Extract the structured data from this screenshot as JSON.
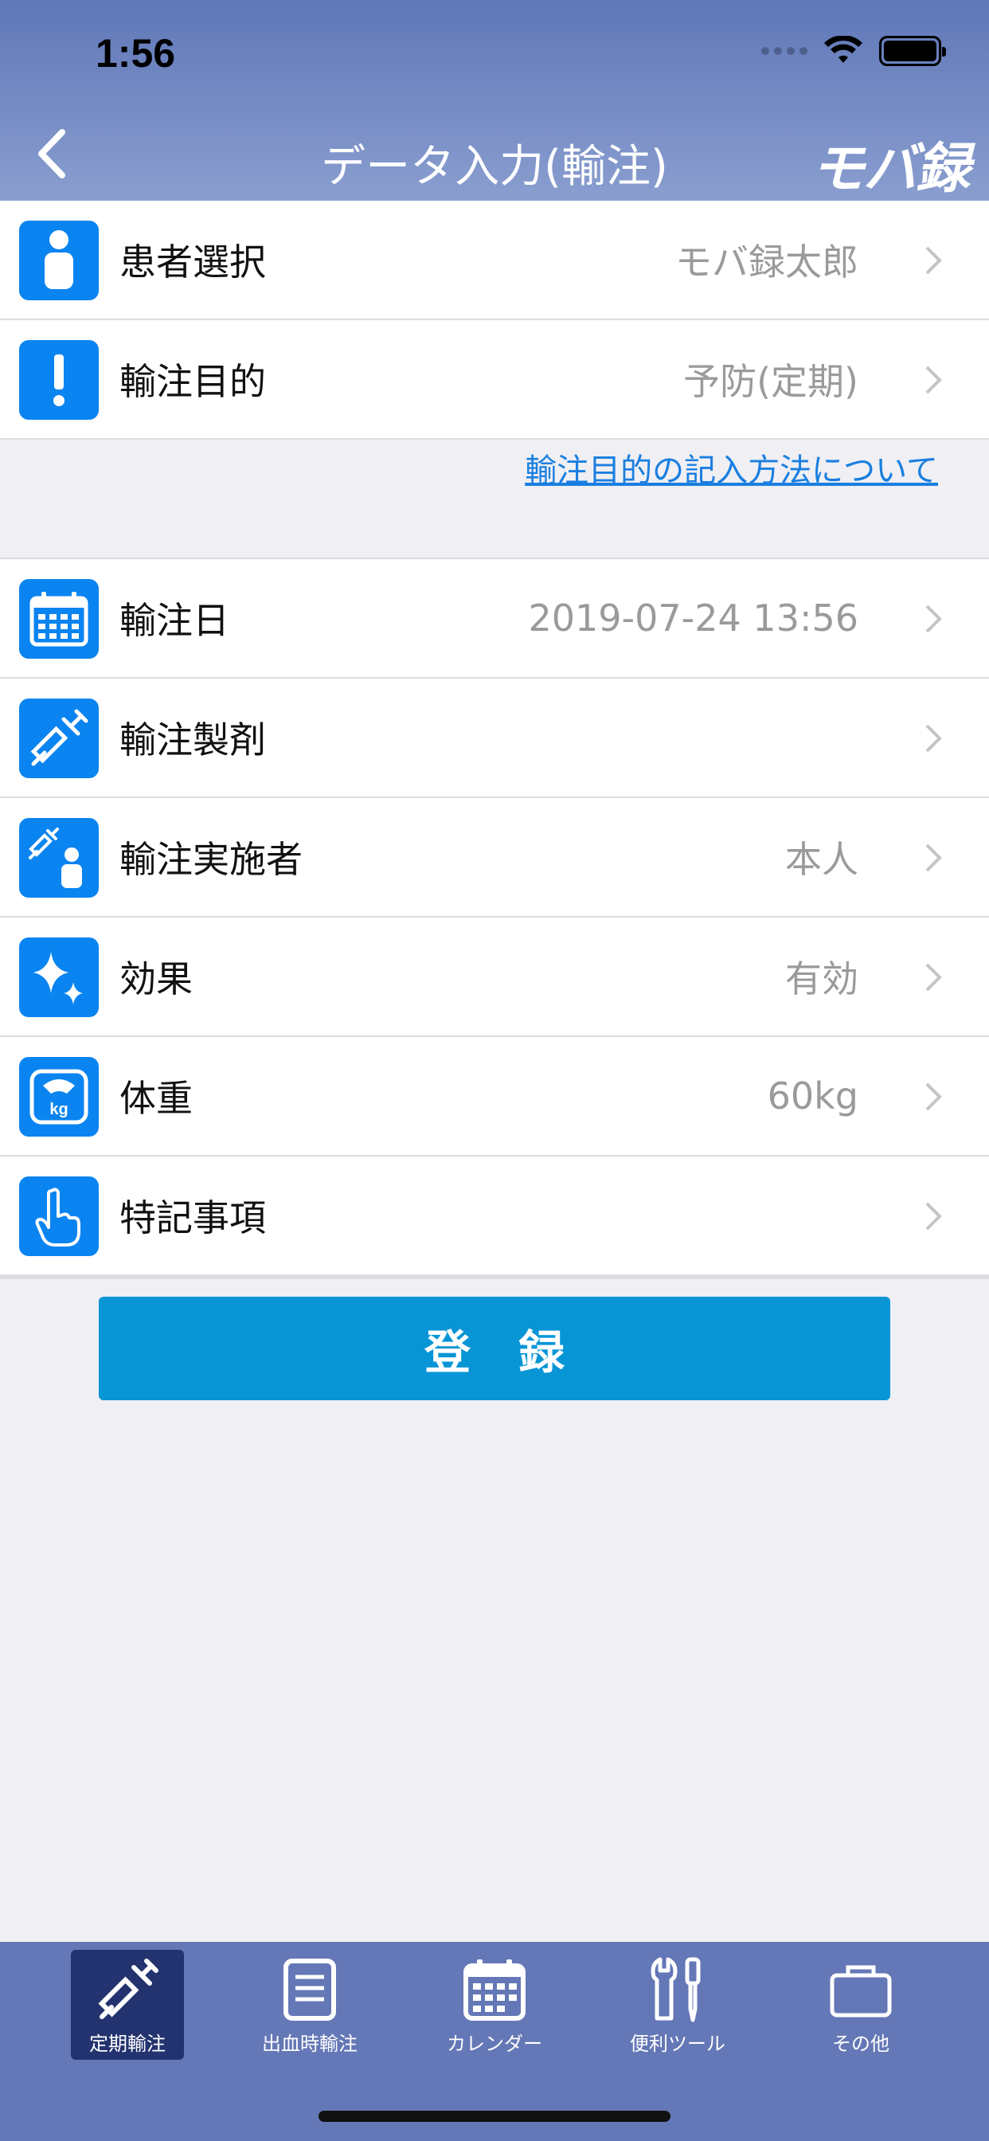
{
  "status": {
    "time": "1:56"
  },
  "nav": {
    "title": "データ入力(輸注)",
    "logo": "モバ録"
  },
  "group1": [
    {
      "label": "患者選択",
      "value": "モバ録太郎",
      "icon": "person-icon"
    },
    {
      "label": "輸注目的",
      "value": "予防(定期)",
      "icon": "exclamation-icon"
    }
  ],
  "link_text": "輸注目的の記入方法について",
  "group2": [
    {
      "label": "輸注日",
      "value": "2019-07-24 13:56",
      "icon": "calendar-icon"
    },
    {
      "label": "輸注製剤",
      "value": "",
      "icon": "syringe-icon"
    },
    {
      "label": "輸注実施者",
      "value": "本人",
      "icon": "syringe-person-icon"
    },
    {
      "label": "効果",
      "value": "有効",
      "icon": "sparkle-icon"
    },
    {
      "label": "体重",
      "value": "60kg",
      "icon": "scale-icon"
    },
    {
      "label": "特記事項",
      "value": "",
      "icon": "pointing-hand-icon"
    }
  ],
  "register_label": "登録",
  "tabs": [
    {
      "label": "定期輸注",
      "icon": "syringe-icon",
      "active": true
    },
    {
      "label": "出血時輸注",
      "icon": "list-icon",
      "active": false
    },
    {
      "label": "カレンダー",
      "icon": "calendar-icon",
      "active": false
    },
    {
      "label": "便利ツール",
      "icon": "tools-icon",
      "active": false
    },
    {
      "label": "その他",
      "icon": "folder-icon",
      "active": false
    }
  ],
  "colors": {
    "accent": "#0a84f0",
    "header": "#5f77b8",
    "tabbar": "#6477b6",
    "button": "#0895d6"
  }
}
